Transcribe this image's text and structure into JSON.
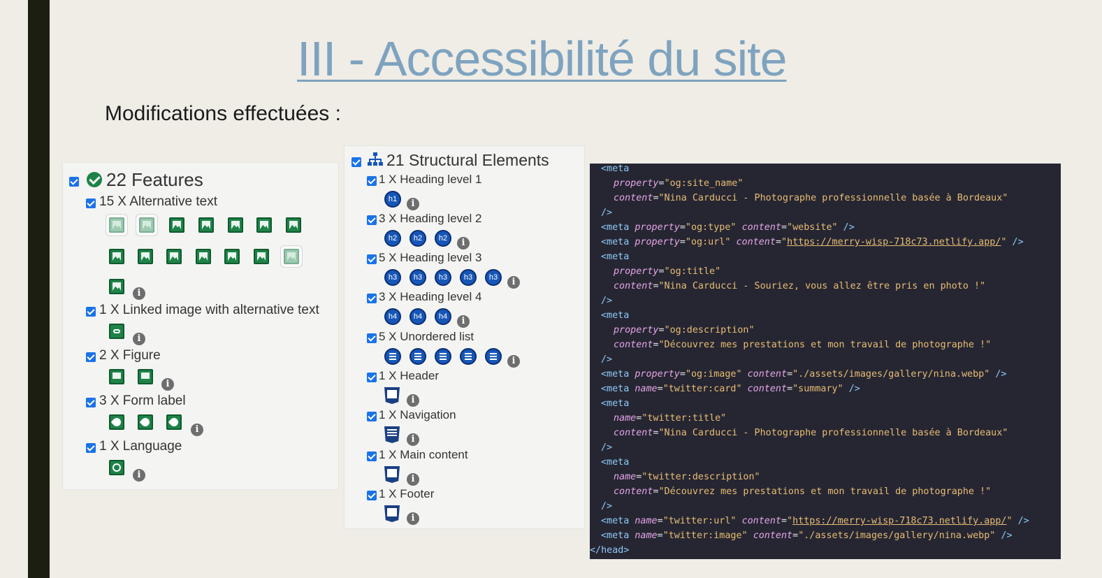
{
  "slide": {
    "title": "III - Accessibilité du site",
    "subtitle": "Modifications effectuées :"
  },
  "features": {
    "title": "22 Features",
    "items": [
      {
        "label": "15 X Alternative text"
      },
      {
        "label": "1 X Linked image with alternative text"
      },
      {
        "label": "2 X Figure"
      },
      {
        "label": "3 X Form label"
      },
      {
        "label": "1 X Language"
      }
    ]
  },
  "structure": {
    "title": "21 Structural Elements",
    "items": [
      {
        "label": "1 X Heading level 1",
        "icon_text": "h1"
      },
      {
        "label": "3 X Heading level 2",
        "icon_text": "h2"
      },
      {
        "label": "5 X Heading level 3",
        "icon_text": "h3"
      },
      {
        "label": "3 X Heading level 4",
        "icon_text": "h4"
      },
      {
        "label": "5 X Unordered list"
      },
      {
        "label": "1 X Header"
      },
      {
        "label": "1 X Navigation"
      },
      {
        "label": "1 X Main content"
      },
      {
        "label": "1 X Footer"
      }
    ]
  },
  "info_glyph": "i",
  "code": {
    "lines": [
      [
        {
          "t": "tg",
          "v": "<meta"
        }
      ],
      [
        {
          "t": "at",
          "v": "property"
        },
        {
          "t": "eq",
          "v": "="
        },
        {
          "t": "st",
          "v": "\"og:site_name\""
        }
      ],
      [
        {
          "t": "at",
          "v": "content"
        },
        {
          "t": "eq",
          "v": "="
        },
        {
          "t": "st",
          "v": "\"Nina Carducci - Photographe professionnelle basée à Bordeaux\""
        }
      ],
      [
        {
          "t": "tg",
          "v": "/>"
        }
      ],
      [
        {
          "t": "tg",
          "v": "<meta "
        },
        {
          "t": "at",
          "v": "property"
        },
        {
          "t": "eq",
          "v": "="
        },
        {
          "t": "st",
          "v": "\"og:type\""
        },
        {
          "t": "eq",
          "v": " "
        },
        {
          "t": "at",
          "v": "content"
        },
        {
          "t": "eq",
          "v": "="
        },
        {
          "t": "st",
          "v": "\"website\""
        },
        {
          "t": "tg",
          "v": " />"
        }
      ],
      [
        {
          "t": "tg",
          "v": "<meta "
        },
        {
          "t": "at",
          "v": "property"
        },
        {
          "t": "eq",
          "v": "="
        },
        {
          "t": "st",
          "v": "\"og:url\""
        },
        {
          "t": "eq",
          "v": " "
        },
        {
          "t": "at",
          "v": "content"
        },
        {
          "t": "eq",
          "v": "="
        },
        {
          "t": "st",
          "v": "\""
        },
        {
          "t": "stu",
          "v": "https://merry-wisp-718c73.netlify.app/"
        },
        {
          "t": "st",
          "v": "\""
        },
        {
          "t": "tg",
          "v": " />"
        }
      ],
      [
        {
          "t": "tg",
          "v": "<meta"
        }
      ],
      [
        {
          "t": "at",
          "v": "property"
        },
        {
          "t": "eq",
          "v": "="
        },
        {
          "t": "st",
          "v": "\"og:title\""
        }
      ],
      [
        {
          "t": "at",
          "v": "content"
        },
        {
          "t": "eq",
          "v": "="
        },
        {
          "t": "st",
          "v": "\"Nina Carducci - Souriez, vous allez être pris en photo !\""
        }
      ],
      [
        {
          "t": "tg",
          "v": "/>"
        }
      ],
      [
        {
          "t": "tg",
          "v": "<meta"
        }
      ],
      [
        {
          "t": "at",
          "v": "property"
        },
        {
          "t": "eq",
          "v": "="
        },
        {
          "t": "st",
          "v": "\"og:description\""
        }
      ],
      [
        {
          "t": "at",
          "v": "content"
        },
        {
          "t": "eq",
          "v": "="
        },
        {
          "t": "st",
          "v": "\"Découvrez mes prestations et mon travail de photographe !\""
        }
      ],
      [
        {
          "t": "tg",
          "v": "/>"
        }
      ],
      [
        {
          "t": "tg",
          "v": "<meta "
        },
        {
          "t": "at",
          "v": "property"
        },
        {
          "t": "eq",
          "v": "="
        },
        {
          "t": "st",
          "v": "\"og:image\""
        },
        {
          "t": "eq",
          "v": " "
        },
        {
          "t": "at",
          "v": "content"
        },
        {
          "t": "eq",
          "v": "="
        },
        {
          "t": "st",
          "v": "\"./assets/images/gallery/nina.webp\""
        },
        {
          "t": "tg",
          "v": " />"
        }
      ],
      [
        {
          "t": "tg",
          "v": "<meta "
        },
        {
          "t": "at",
          "v": "name"
        },
        {
          "t": "eq",
          "v": "="
        },
        {
          "t": "st",
          "v": "\"twitter:card\""
        },
        {
          "t": "eq",
          "v": " "
        },
        {
          "t": "at",
          "v": "content"
        },
        {
          "t": "eq",
          "v": "="
        },
        {
          "t": "st",
          "v": "\"summary\""
        },
        {
          "t": "tg",
          "v": " />"
        }
      ],
      [
        {
          "t": "tg",
          "v": "<meta"
        }
      ],
      [
        {
          "t": "at",
          "v": "name"
        },
        {
          "t": "eq",
          "v": "="
        },
        {
          "t": "st",
          "v": "\"twitter:title\""
        }
      ],
      [
        {
          "t": "at",
          "v": "content"
        },
        {
          "t": "eq",
          "v": "="
        },
        {
          "t": "st",
          "v": "\"Nina Carducci - Photographe professionnelle basée à Bordeaux\""
        }
      ],
      [
        {
          "t": "tg",
          "v": "/>"
        }
      ],
      [
        {
          "t": "tg",
          "v": "<meta"
        }
      ],
      [
        {
          "t": "at",
          "v": "name"
        },
        {
          "t": "eq",
          "v": "="
        },
        {
          "t": "st",
          "v": "\"twitter:description\""
        }
      ],
      [
        {
          "t": "at",
          "v": "content"
        },
        {
          "t": "eq",
          "v": "="
        },
        {
          "t": "st",
          "v": "\"Découvrez mes prestations et mon travail de photographe !\""
        }
      ],
      [
        {
          "t": "tg",
          "v": "/>"
        }
      ],
      [
        {
          "t": "tg",
          "v": "<meta "
        },
        {
          "t": "at",
          "v": "name"
        },
        {
          "t": "eq",
          "v": "="
        },
        {
          "t": "st",
          "v": "\"twitter:url\""
        },
        {
          "t": "eq",
          "v": " "
        },
        {
          "t": "at",
          "v": "content"
        },
        {
          "t": "eq",
          "v": "="
        },
        {
          "t": "st",
          "v": "\""
        },
        {
          "t": "stu",
          "v": "https://merry-wisp-718c73.netlify.app/"
        },
        {
          "t": "st",
          "v": "\""
        },
        {
          "t": "tg",
          "v": " />"
        }
      ],
      [
        {
          "t": "tg",
          "v": "<meta "
        },
        {
          "t": "at",
          "v": "name"
        },
        {
          "t": "eq",
          "v": "="
        },
        {
          "t": "st",
          "v": "\"twitter:image\""
        },
        {
          "t": "eq",
          "v": " "
        },
        {
          "t": "at",
          "v": "content"
        },
        {
          "t": "eq",
          "v": "="
        },
        {
          "t": "st",
          "v": "\"./assets/images/gallery/nina.webp\""
        },
        {
          "t": "tg",
          "v": " />"
        }
      ],
      [
        {
          "t": "tg",
          "v": "</head>"
        }
      ]
    ]
  },
  "colors": {
    "title": "#7fa3bf",
    "feature_green": "#1e8348",
    "structure_blue": "#1656b6",
    "code_bg": "#262633"
  }
}
